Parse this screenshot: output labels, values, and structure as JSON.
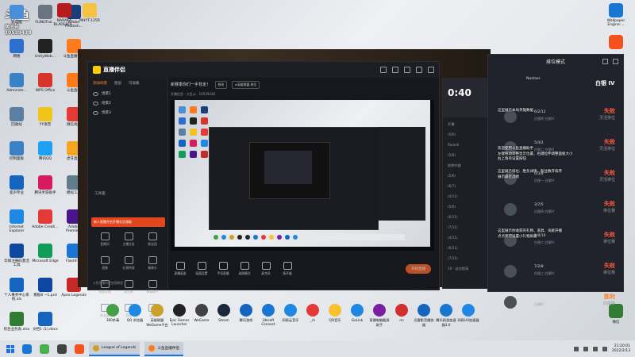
{
  "watermark": {
    "label": "房间号",
    "room_id": "10539438"
  },
  "desktop_left": [
    {
      "label": "此电脑",
      "color": "#4a90d9"
    },
    {
      "label": "FLINGTrai...",
      "color": "#6b7480"
    },
    {
      "label": "Adobe Photosh...",
      "color": "#1b3d7a"
    },
    {
      "label": "网络",
      "color": "#2b6fd0"
    },
    {
      "label": "UnityWeb...",
      "color": "#222"
    },
    {
      "label": "斗鱼直播伴侣",
      "color": "#ff7a1a"
    },
    {
      "label": "Administr...",
      "color": "#3b82c4"
    },
    {
      "label": "WPS Office",
      "color": "#d9342b"
    },
    {
      "label": "斗鱼直播",
      "color": "#ff7a1a"
    },
    {
      "label": "回收站",
      "color": "#5a7fa3"
    },
    {
      "label": "YY语音",
      "color": "#f0c419"
    },
    {
      "label": "微信视频",
      "color": "#e53935"
    },
    {
      "label": "控制面板",
      "color": "#3b82c4"
    },
    {
      "label": "腾讯QQ",
      "color": "#1da1f2"
    },
    {
      "label": "虎牙直播",
      "color": "#f5a623"
    },
    {
      "label": "变声专业",
      "color": "#1565c0"
    },
    {
      "label": "腾讯手游助手",
      "color": "#d81b60"
    },
    {
      "label": "模拟工厂",
      "color": "#607d8b"
    },
    {
      "label": "Internet Explorer",
      "color": "#1e88e5"
    },
    {
      "label": "Adobe Creati...",
      "color": "#e53935"
    },
    {
      "label": "Adobe Premie...",
      "color": "#4a148c"
    },
    {
      "label": "华硕注册码激活工具",
      "color": "#0d47a1"
    },
    {
      "label": "Microsoft Edge",
      "color": "#0f9d58"
    },
    {
      "label": "FlashFXP",
      "color": "#1976d2"
    },
    {
      "label": "个人事务中心系统.xls",
      "color": "#1565c0"
    },
    {
      "label": "模板8 ~1.psd",
      "color": "#0d47a1"
    },
    {
      "label": "Apex Legends",
      "color": "#c62828"
    },
    {
      "label": "综合业务表.xlsx",
      "color": "#2e7d32"
    },
    {
      "label": "文档1 (1).docx",
      "color": "#1565c0"
    }
  ],
  "desktop_top": [
    {
      "label": "NARAKA BLADEPOI...",
      "color": "#b71c1c"
    },
    {
      "label": "MHYT-125R",
      "color": "#f6c244"
    }
  ],
  "app": {
    "brand": "直播伴侣",
    "tabs": [
      "添加场景",
      "图层",
      "可收集"
    ],
    "scenes": [
      "场景1",
      "场景2",
      "场景3"
    ],
    "tools_label": "工具箱",
    "tools": [
      "直播间",
      "主播任务",
      "粉丝团",
      "直播",
      "礼物特效",
      "摄像头",
      "视频音效",
      "送礼物",
      "弹幕助手",
      "成长值",
      "音频",
      "语音"
    ],
    "promo": "新人直播开启开播礼包领取",
    "left_footer": "斗鱼直播伴侣使用教程",
    "stream_title": "新赛季你们一手背走！",
    "edit_btn": "修改",
    "category_btn": "#英雄联盟-排位",
    "sub_info": "开播信息 · 大乱斗 · 10539438",
    "controls": [
      "直播画面",
      "画面设置",
      "手机直播",
      "录屏模式",
      "麦克风",
      "扬声器"
    ],
    "go_live": "开始直播",
    "chat_timer": "0:40",
    "chat_lines": [
      "开播",
      "(5/6)",
      "floandl",
      "(5/6)",
      "前期中路",
      "(5/6)",
      "(6/7)",
      "(4/11)",
      "(5/6)",
      "(6/11)",
      "(7/11)",
      "(4/11)",
      "(6/11)",
      "(7/11)",
      "10 - 这也提高"
    ]
  },
  "rank": {
    "title": "排位模式",
    "tier": "白银 IV",
    "player": "Nastaer",
    "rows": [
      {
        "score": "6/2/12",
        "tier": "白银四 白银IV",
        "result": "失败",
        "mode": "灵活排位"
      },
      {
        "score": "5/4/2",
        "tier": "白银二 白银IV",
        "result": "失败",
        "mode": "灵活排位"
      },
      {
        "score": "6/3/8",
        "tier": "白银一 白银IV",
        "result": "失败",
        "mode": "灵活排位"
      },
      {
        "score": "3/7/5",
        "tier": "白银四 白银IV",
        "result": "失败",
        "mode": "排位赛"
      },
      {
        "score": "1/8/10",
        "tier": "白银二 白银IV",
        "result": "失败",
        "mode": "排位赛"
      },
      {
        "score": "7/2/8",
        "tier": "白银三 白银IV",
        "result": "失败",
        "mode": "排位赛"
      },
      {
        "score": "6/8/8",
        "tier": "白银IV",
        "result": "胜利",
        "mode": "匹配赛"
      }
    ],
    "overlay_1": "这里展示本局英雄数据",
    "overlay_2": "欢迎使用斗鱼直播助手\n左键拖动调整显示位置，右键拉伸调整面板大小\n右上角有设置按钮",
    "overlay_3": "这里展示排位、胜负详情，粉丝数开排序\n展示最近战绩",
    "overlay_4": "这里展示你收获的礼物、道具、贡献开播\n点点奖可设置小礼物屏蔽"
  },
  "desktop_right": [
    {
      "label": "Wallpaper Engine:...",
      "color": "#1976d2"
    },
    {
      "label": "",
      "color": "#f4511e"
    },
    {
      "label": "微信",
      "color": "#2e7d32"
    }
  ],
  "dock": [
    {
      "label": "360杀毒",
      "color": "#43a047"
    },
    {
      "label": "QQ 浏览器",
      "color": "#1e88e5"
    },
    {
      "label": "英雄联盟WeGame平台",
      "color": "#c9a227"
    },
    {
      "label": "Epic Games Launcher",
      "color": "#222"
    },
    {
      "label": "WeGame",
      "color": "#424242"
    },
    {
      "label": "Steam",
      "color": "#1b2838"
    },
    {
      "label": "腾讯游戏",
      "color": "#1565c0"
    },
    {
      "label": "Ubisoft Connect",
      "color": "#1976d2"
    },
    {
      "label": "网易云音乐",
      "color": "#1e88e5"
    },
    {
      "label": "_m",
      "color": "#e53935"
    },
    {
      "label": "QQ音乐",
      "color": "#fbc02d"
    },
    {
      "label": "GoLink",
      "color": "#1e88e5"
    },
    {
      "label": "直播电脑截屏助手",
      "color": "#7b1fa2"
    },
    {
      "label": "nn",
      "color": "#d32f2f"
    },
    {
      "label": "迅雷影音播放器",
      "color": "#1565c0"
    },
    {
      "label": "腾讯网游加速器3.0",
      "color": "#1976d2"
    },
    {
      "label": "网易UU加速器",
      "color": "#1e88e5"
    }
  ],
  "taskbar": {
    "tasks": [
      {
        "label": "League of Legends",
        "color": "#c9a227"
      },
      {
        "label": "斗鱼直播伴侣",
        "color": "#ff7a1a"
      }
    ],
    "time": "21:20:01",
    "date": "2022/2/13"
  }
}
